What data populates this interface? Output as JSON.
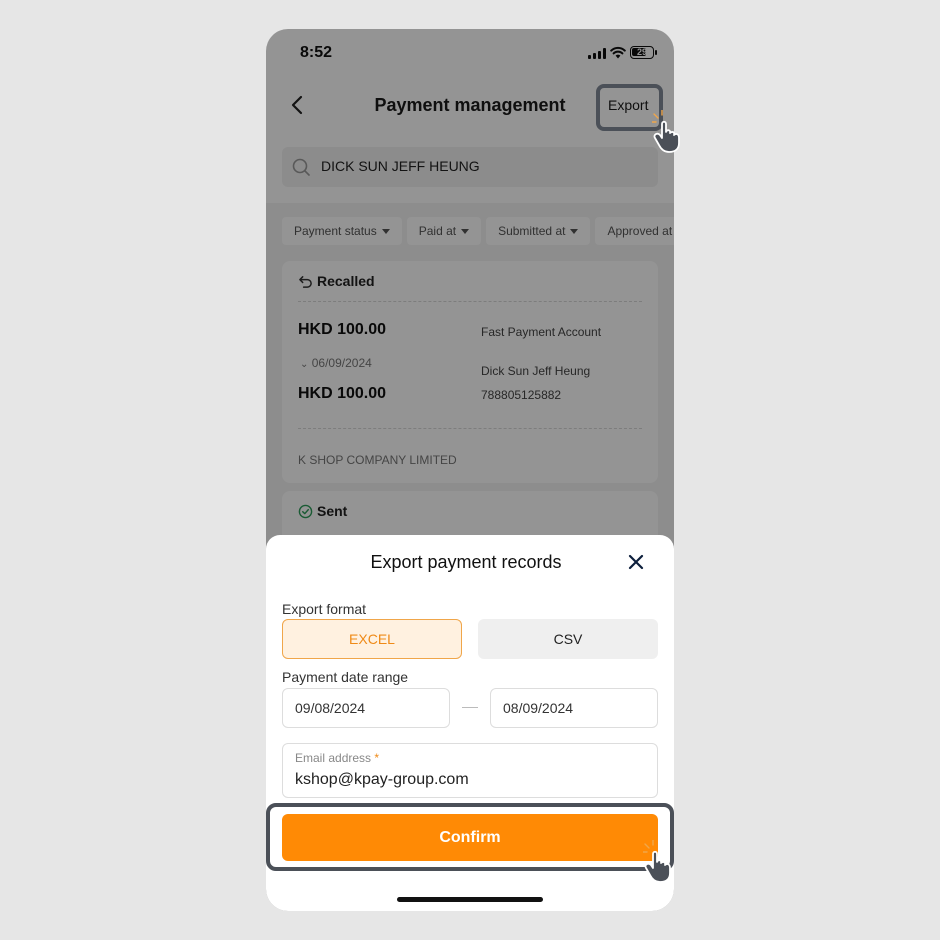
{
  "status_bar": {
    "time": "8:52",
    "battery": "29"
  },
  "header": {
    "title": "Payment management",
    "export_label": "Export"
  },
  "search": {
    "value": "DICK SUN JEFF HEUNG"
  },
  "filters": [
    "Payment status",
    "Paid at",
    "Submitted at",
    "Approved at"
  ],
  "cards": [
    {
      "status": "Recalled",
      "amount": "HKD 100.00",
      "date": "06/09/2024",
      "amount2": "HKD 100.00",
      "account_type": "Fast Payment Account",
      "payee": "Dick Sun Jeff Heung",
      "account_no": "788805125882",
      "company": "K SHOP COMPANY LIMITED"
    },
    {
      "status": "Sent"
    }
  ],
  "sheet": {
    "title": "Export payment records",
    "format_label": "Export format",
    "formats": {
      "excel": "EXCEL",
      "csv": "CSV"
    },
    "selected_format": "EXCEL",
    "date_range_label": "Payment date range",
    "date_from": "09/08/2024",
    "date_to": "08/09/2024",
    "email_label": "Email address",
    "email_required": "*",
    "email_value": "kshop@kpay-group.com",
    "confirm_label": "Confirm"
  },
  "colors": {
    "accent": "#ff8a05",
    "accent_light": "#fff1e0",
    "highlight": "#4b5058"
  }
}
